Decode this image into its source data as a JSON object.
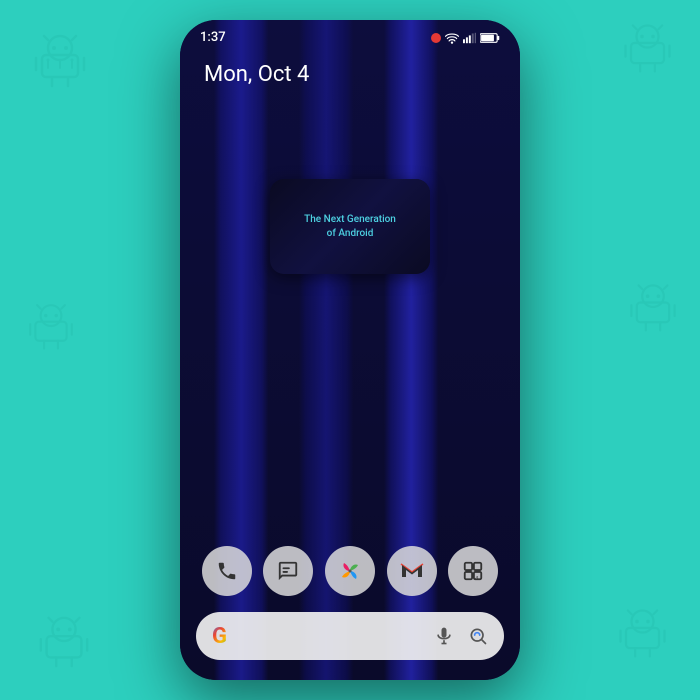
{
  "background": {
    "color": "#2dcfbe"
  },
  "phone": {
    "status_bar": {
      "time": "1:37",
      "icons": [
        "record-icon",
        "wifi-icon",
        "signal-icon",
        "battery-icon"
      ]
    },
    "date": "Mon, Oct 4",
    "video_widget": {
      "line1": "The Next Generation",
      "line2": "of Android"
    },
    "dock": {
      "items": [
        {
          "name": "phone",
          "icon": "📞"
        },
        {
          "name": "messages",
          "icon": "💬"
        },
        {
          "name": "pinwheel",
          "icon": "✳"
        },
        {
          "name": "gmail",
          "icon": "M"
        },
        {
          "name": "overview",
          "icon": "⧉"
        }
      ]
    },
    "search_bar": {
      "google_letter": "G",
      "mic_icon": "🎤",
      "lens_icon": "⊙"
    }
  }
}
